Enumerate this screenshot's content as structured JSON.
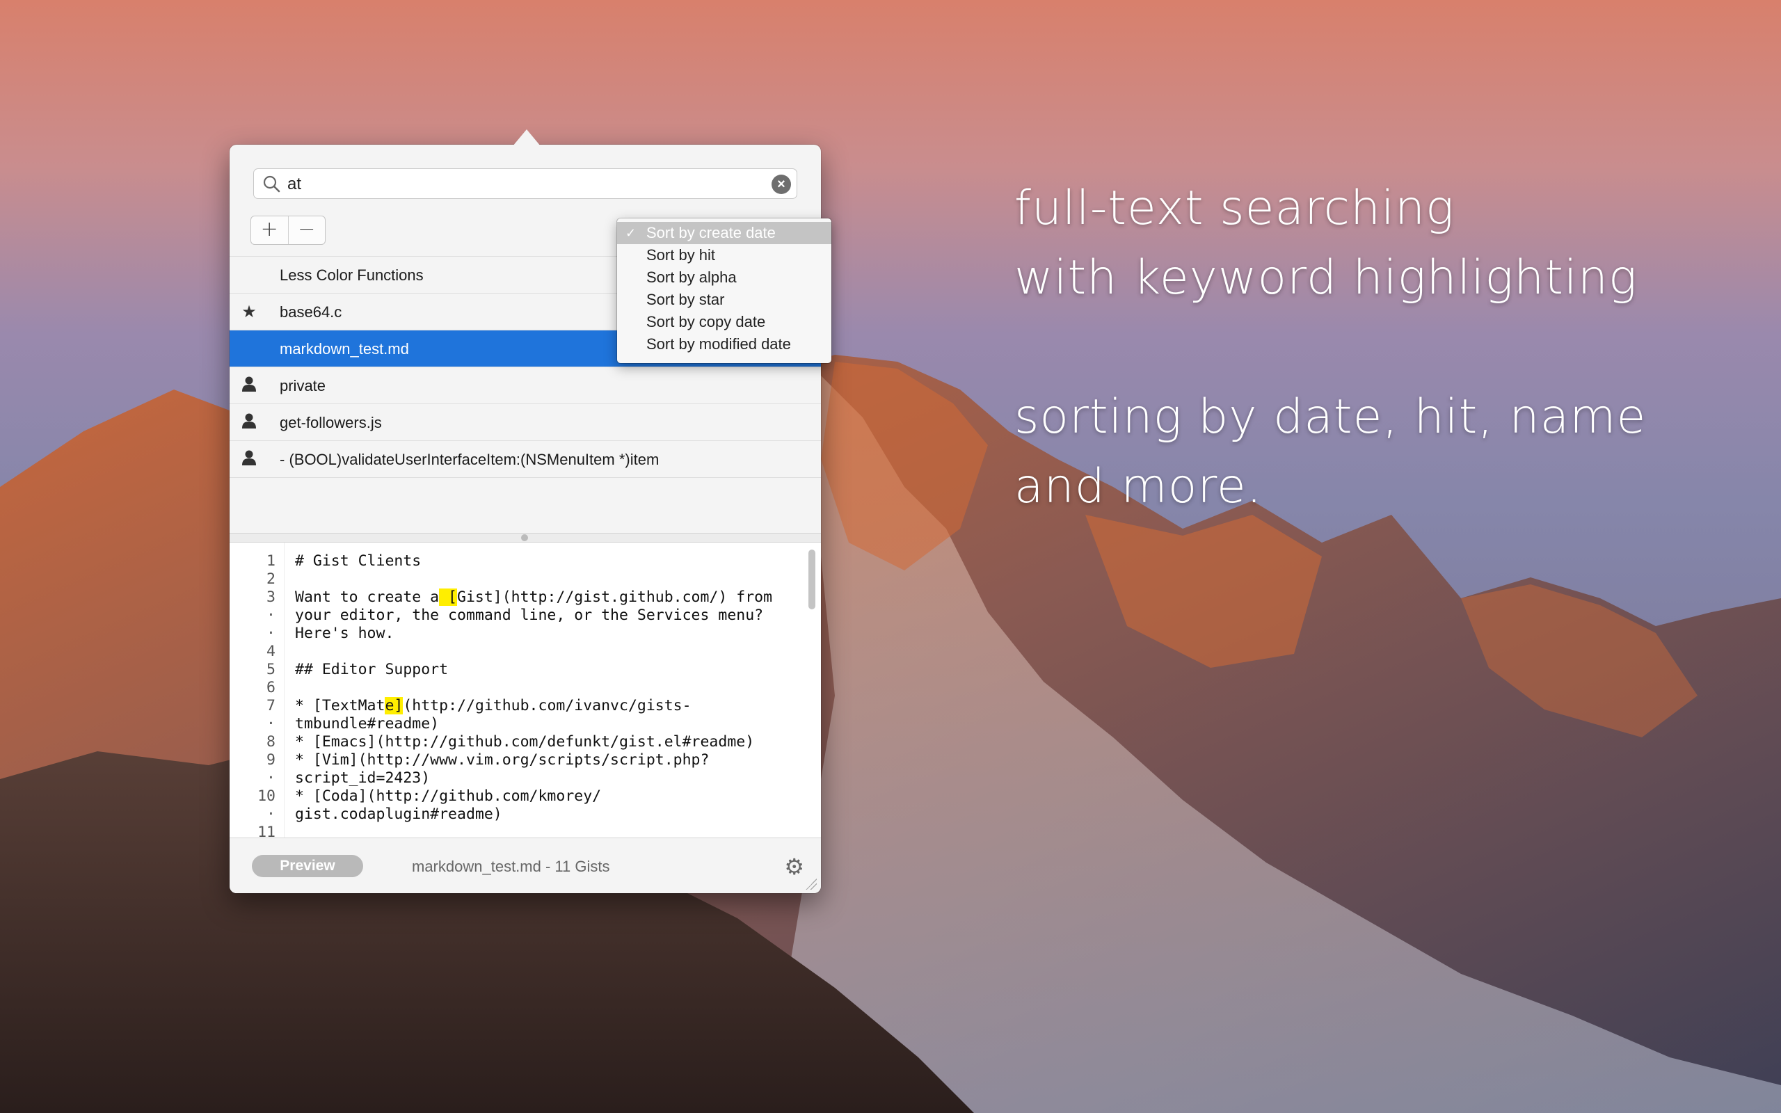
{
  "search": {
    "value": "at",
    "clear_icon": "clear-icon",
    "search_icon": "magnifier-icon"
  },
  "toolbar": {
    "add_label": "+",
    "remove_label": "−"
  },
  "gists": [
    {
      "icon": "",
      "name": "Less Color Functions",
      "selected": false
    },
    {
      "icon": "★",
      "name": "base64.c",
      "selected": false
    },
    {
      "icon": "",
      "name": "markdown_test.md",
      "selected": true
    },
    {
      "icon": "👤",
      "name": "private",
      "selected": false
    },
    {
      "icon": "👤",
      "name": "get-followers.js",
      "selected": false
    },
    {
      "icon": "👤",
      "name": "- (BOOL)validateUserInterfaceItem:(NSMenuItem *)item",
      "selected": false
    }
  ],
  "sort_menu": {
    "items": [
      {
        "label": "Sort by create date",
        "checked": true
      },
      {
        "label": "Sort by hit",
        "checked": false
      },
      {
        "label": "Sort by alpha",
        "checked": false
      },
      {
        "label": "Sort by star",
        "checked": false
      },
      {
        "label": "Sort by copy date",
        "checked": false
      },
      {
        "label": "Sort by modified date",
        "checked": false
      }
    ]
  },
  "editor": {
    "lines": [
      {
        "num": "1",
        "text": "# Gist Clients"
      },
      {
        "num": "2",
        "text": ""
      },
      {
        "num": "3",
        "text": "Want to create a [Gist](http://gist.github.com/) from"
      },
      {
        "num": "·",
        "text": "your editor, the command line, or the Services menu?"
      },
      {
        "num": "·",
        "text": "Here's how."
      },
      {
        "num": "4",
        "text": ""
      },
      {
        "num": "5",
        "text": "## Editor Support"
      },
      {
        "num": "6",
        "text": ""
      },
      {
        "num": "7",
        "text": "* [TextMate](http://github.com/ivanvc/gists-"
      },
      {
        "num": "·",
        "text": "tmbundle#readme)"
      },
      {
        "num": "8",
        "text": "* [Emacs](http://github.com/defunkt/gist.el#readme)"
      },
      {
        "num": "9",
        "text": "* [Vim](http://www.vim.org/scripts/script.php?"
      },
      {
        "num": "·",
        "text": "script_id=2423)"
      },
      {
        "num": "10",
        "text": "* [Coda](http://github.com/kmorey/"
      },
      {
        "num": "·",
        "text": "gist.codaplugin#readme)"
      },
      {
        "num": "11",
        "text": ""
      }
    ],
    "highlight_keyword": "at"
  },
  "bottom": {
    "preview_label": "Preview",
    "status": "markdown_test.md - 11 Gists",
    "settings_icon": "gear-icon"
  },
  "promo": {
    "line1": "full-text searching\nwith keyword highlighting",
    "line2": "sorting by date, hit, name\nand more."
  }
}
